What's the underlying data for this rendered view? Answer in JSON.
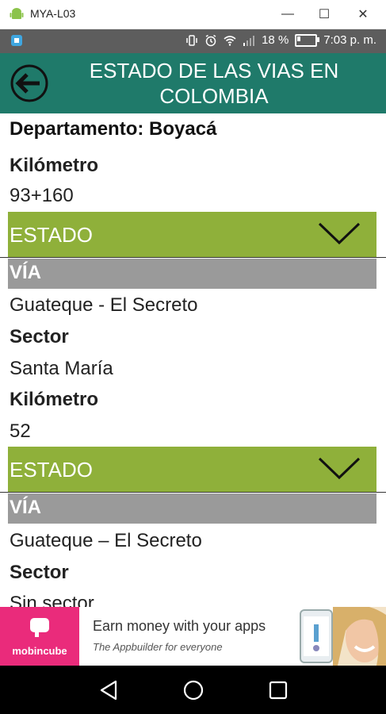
{
  "window": {
    "title": "MYA-L03",
    "minimize_glyph": "—",
    "maximize_glyph": "☐",
    "close_glyph": "✕"
  },
  "status_bar": {
    "battery": "18 %",
    "battery_level": 0.18,
    "time": "7:03 p. m."
  },
  "header": {
    "title": "ESTADO DE LAS VIAS EN COLOMBIA"
  },
  "department": {
    "label": "Departamento: Boyacá"
  },
  "colors": {
    "header": "#1f7a6a",
    "estado_bar": "#8fb03a",
    "via_bar": "#9a9a9a",
    "ad_brand": "#ea2b7b"
  },
  "records": {
    "first_tail": {
      "km_label": "Kilómetro",
      "km_value": "93+160",
      "estado_label": "ESTADO"
    },
    "second": {
      "via_label": "VÍA",
      "via_value": "Guateque - El Secreto",
      "sector_label": "Sector",
      "sector_value": "Santa María",
      "km_label": "Kilómetro",
      "km_value": "52",
      "estado_label": "ESTADO"
    },
    "third": {
      "via_label": "VÍA",
      "via_value": "Guateque – El Secreto",
      "sector_label": "Sector",
      "sector_value": "Sin sector"
    }
  },
  "ad": {
    "brand": "mobincube",
    "headline": "Earn money with your apps",
    "subline": "The Appbuilder for everyone"
  },
  "icons": {
    "title_app": "android-icon",
    "back": "back-arrow-icon",
    "expand": "chevron-down-icon"
  }
}
